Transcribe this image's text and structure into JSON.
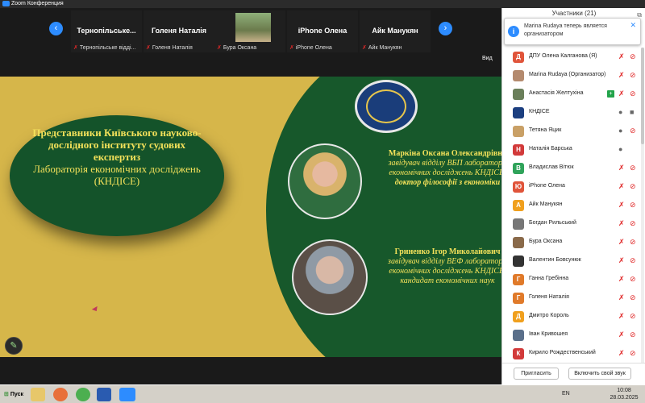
{
  "window": {
    "title": "Zoom Конференция"
  },
  "strip": {
    "tiles": [
      {
        "name": "Тернопільське...",
        "label": "Тернопільське відді..."
      },
      {
        "name": "Голеня Наталія",
        "label": "Голеня Наталія"
      },
      {
        "name": "",
        "label": "Бура Оксана"
      },
      {
        "name": "iPhone Олена",
        "label": "iPhone Олена"
      },
      {
        "name": "Айк Манукян",
        "label": "Айк Манукян"
      }
    ],
    "view_label": "Вид"
  },
  "slide": {
    "oval_bold": "Представники Київського науково-дослідного інституту судових експертиз",
    "oval_normal": "Лабораторія економічних досліджень",
    "oval_abbr": "(КНДІСЕ)",
    "person1_name": "Маркіна Оксана Олександрівна",
    "person1_role": "завідувач відділу ВБП лабораторії економічних досліджень КНДІСЕ,",
    "person1_degree": "доктор філософії з економіки",
    "person2_name": "Гриненко Ігор Миколайович",
    "person2_role": "завідувач відділу ВЕФ лабораторії економічних досліджень КНДІСЕ, кандидат економічних наук"
  },
  "panel": {
    "header": "Участники (21)",
    "notification": "Marina Rudaya теперь является организатором",
    "participants": [
      {
        "initial": "Д",
        "color": "#e0543a",
        "name": "ДПУ Олена Калганова (Я)",
        "mic": "off",
        "cam": "off"
      },
      {
        "initial": "",
        "color": "#b48a6e",
        "name": "Marina Rudaya (Организатор)",
        "mic": "off",
        "cam": "off"
      },
      {
        "initial": "",
        "color": "#6a7f5a",
        "name": "Анастасія Желтухіна",
        "mic": "off",
        "cam": "off",
        "badge": "+"
      },
      {
        "initial": "",
        "color": "#1c3f80",
        "name": "КНДІСЕ",
        "mic": "on",
        "cam": "on"
      },
      {
        "initial": "",
        "color": "#c9a066",
        "name": "Тетяна Яцик",
        "mic": "on",
        "cam": "off"
      },
      {
        "initial": "Н",
        "color": "#d23a3a",
        "name": "Наталія Барська",
        "mic": "on",
        "cam": ""
      },
      {
        "initial": "В",
        "color": "#2fa35a",
        "name": "Владислав Вітюк",
        "mic": "off",
        "cam": "off"
      },
      {
        "initial": "Ю",
        "color": "#e0543a",
        "name": "iPhone Олена",
        "mic": "off",
        "cam": "off"
      },
      {
        "initial": "А",
        "color": "#f0a01e",
        "name": "Айк Манукян",
        "mic": "off",
        "cam": "off"
      },
      {
        "initial": "",
        "color": "#777",
        "name": "Богдан Рильський",
        "mic": "off",
        "cam": "off"
      },
      {
        "initial": "",
        "color": "#8a6a4a",
        "name": "Бура Оксана",
        "mic": "off",
        "cam": "off"
      },
      {
        "initial": "",
        "color": "#333",
        "name": "Валентин Бовсунюк",
        "mic": "off",
        "cam": "off"
      },
      {
        "initial": "Г",
        "color": "#e07a2a",
        "name": "Ганна Гребінна",
        "mic": "off",
        "cam": "off"
      },
      {
        "initial": "Г",
        "color": "#e07a2a",
        "name": "Голеня Наталія",
        "mic": "off",
        "cam": "off"
      },
      {
        "initial": "Д",
        "color": "#f0a01e",
        "name": "Дмитро Король",
        "mic": "off",
        "cam": "off"
      },
      {
        "initial": "",
        "color": "#5a6f8a",
        "name": "Іван Кривошея",
        "mic": "off",
        "cam": "off"
      },
      {
        "initial": "К",
        "color": "#d23a3a",
        "name": "Кирило Рождественський",
        "mic": "off",
        "cam": "off"
      }
    ],
    "invite_label": "Пригласить",
    "unmute_label": "Включить свой звук"
  },
  "taskbar": {
    "start_label": "Пуск",
    "lang": "EN",
    "time": "10:08",
    "date": "28.03.2025"
  }
}
